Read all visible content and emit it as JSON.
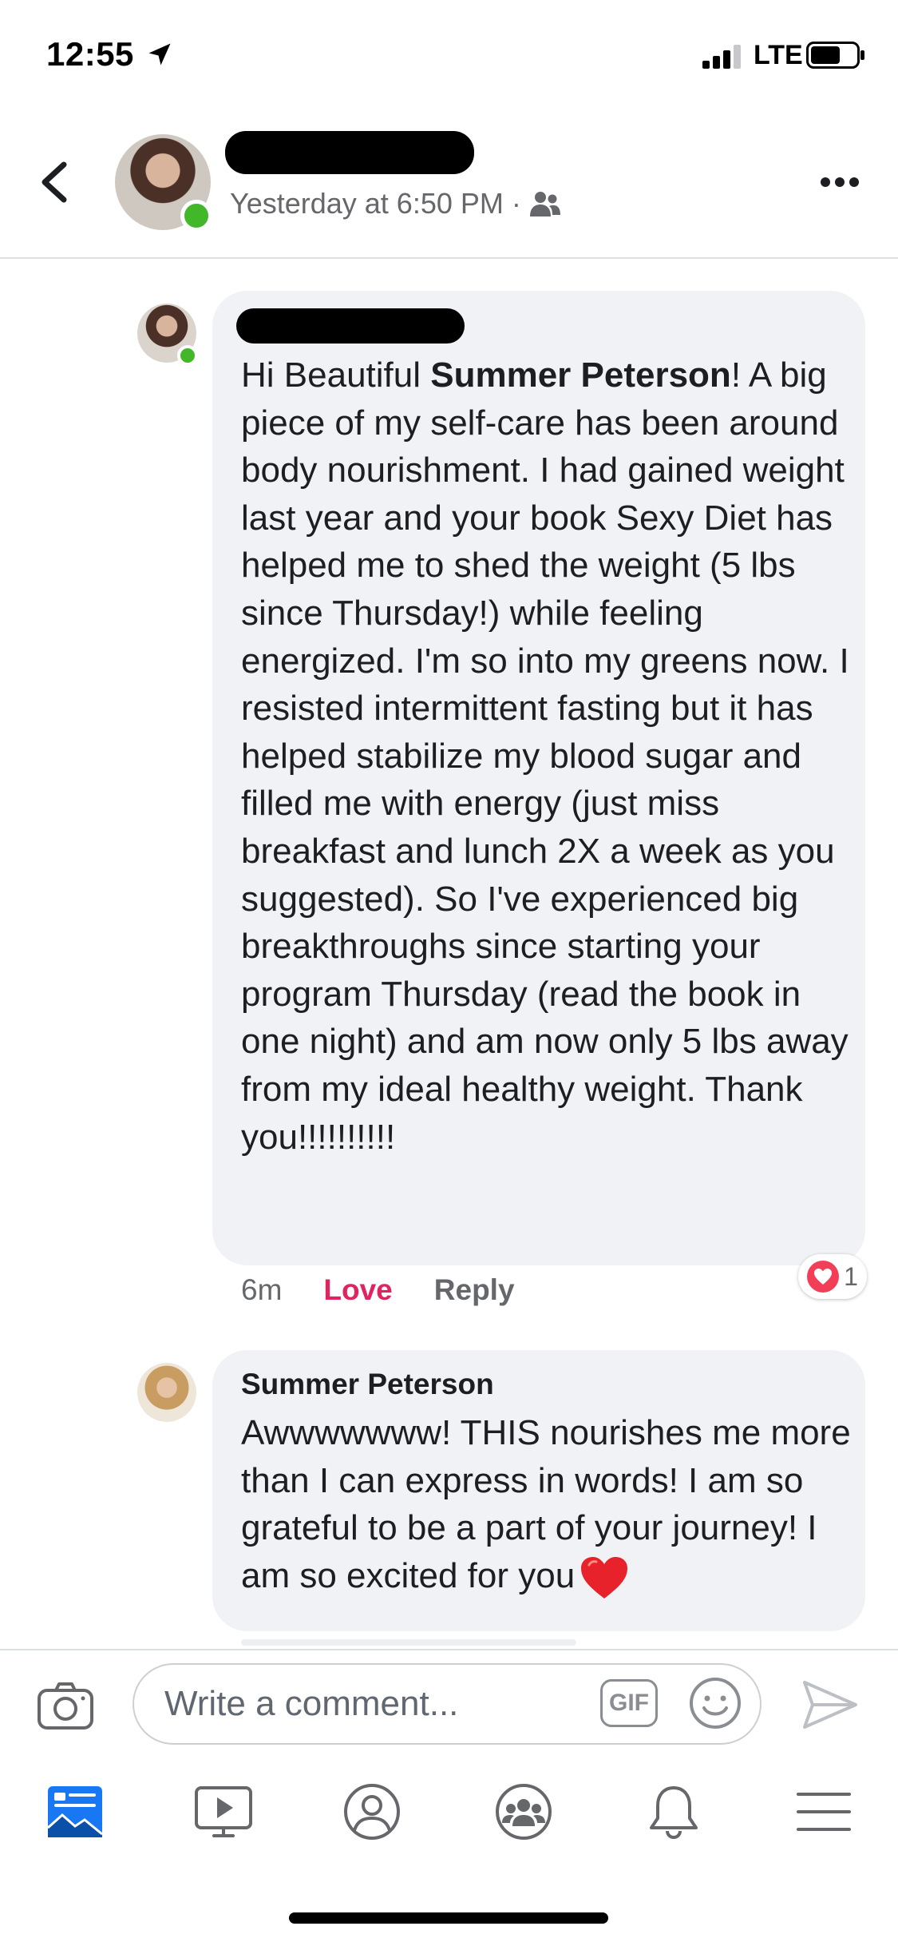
{
  "status_bar": {
    "time": "12:55",
    "network": "LTE"
  },
  "header": {
    "timestamp": "Yesterday at 6:50 PM",
    "separator": "·",
    "audience_icon": "friends-icon"
  },
  "comments": [
    {
      "author": "",
      "text_parts": [
        "Hi Beautiful ",
        "Summer Peterson",
        "! A big piece of my self-care has been around body nourishment. I had gained weight last year and your book Sexy Diet has helped me to shed the weight (5 lbs since Thursday!) while feeling energized. I'm so into my greens now. I resisted intermittent fasting but it has helped stabilize my blood sugar and filled me with energy (just miss breakfast and lunch 2X a week as you suggested). So I've experienced big breakthroughs since starting your program Thursday (read the book in one night) and am now only 5 lbs away from my ideal healthy weight. Thank you!!!!!!!!!!"
      ],
      "time": "6m",
      "love_label": "Love",
      "reply_label": "Reply",
      "reaction_count": "1",
      "reaction_icon": "heart-icon"
    },
    {
      "author": "Summer Peterson",
      "text": "Awwwwwww! THIS nourishes me more than I can express in words! I am so grateful to be a part of your journey! I am so excited for you",
      "emoji": "red-heart-icon"
    }
  ],
  "composer": {
    "placeholder": "Write a comment...",
    "gif_label": "GIF"
  },
  "bottom_nav": [
    "news-feed-icon",
    "watch-icon",
    "profile-icon",
    "groups-icon",
    "notifications-icon",
    "menu-icon"
  ],
  "colors": {
    "love": "#e0245e",
    "online": "#42b72a",
    "active_nav": "#1877f2",
    "bubble": "#f0f2f5"
  }
}
